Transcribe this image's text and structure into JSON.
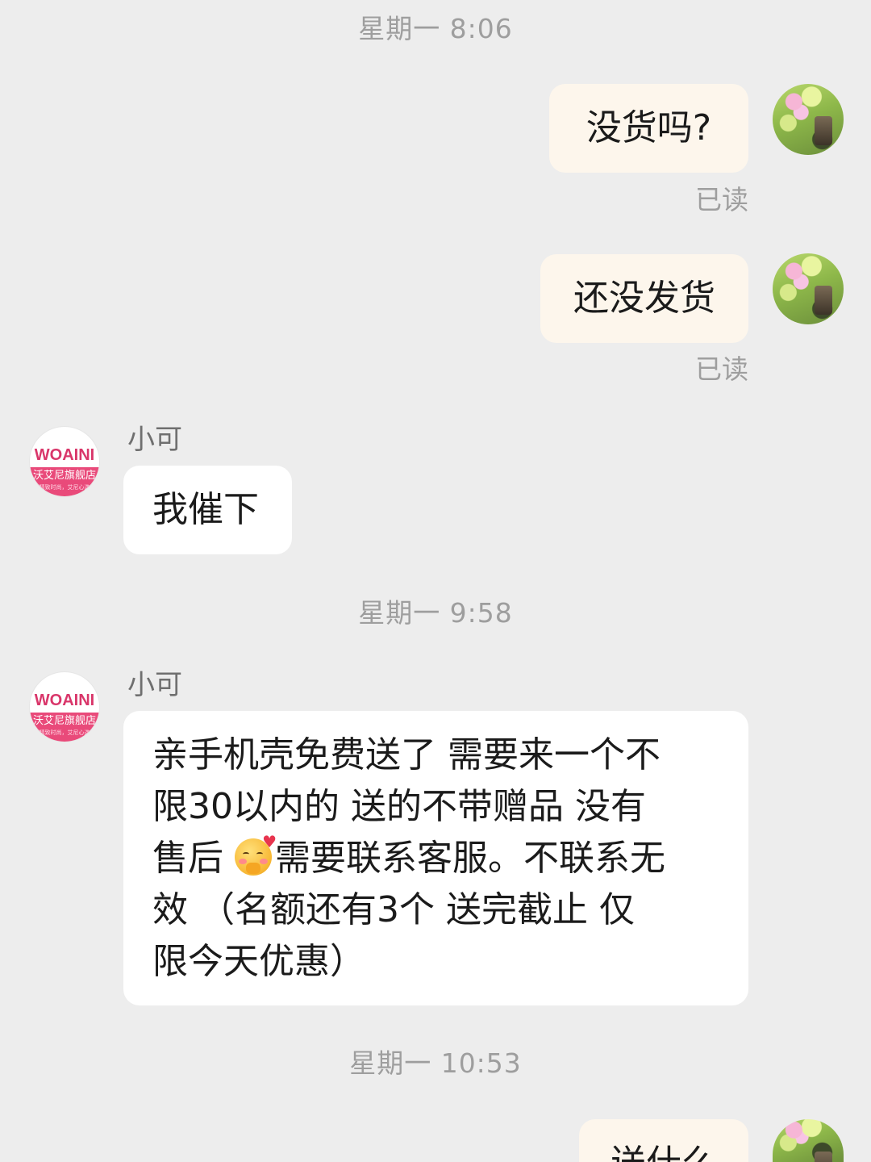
{
  "chat": {
    "timestamps": [
      "星期一 8:06",
      "星期一 9:58",
      "星期一 10:53"
    ],
    "read_label": "已读",
    "sender_name": "小可",
    "shop_avatar": {
      "logo_text": "WOAINI",
      "band_text": "沃艾尼旗舰店",
      "band_subtext": "精致时尚，艾尼心选"
    },
    "messages": [
      {
        "from": "me",
        "text": "没货吗?"
      },
      {
        "from": "me",
        "text": "还没发货"
      },
      {
        "from": "shop",
        "text": "我催下"
      },
      {
        "from": "shop",
        "lines": [
          "亲手机壳免费送了 需要来一个不",
          "限30以内的   送的不带赠品 没有",
          "售后 ",
          "需要联系客服。不联系无",
          "效    （名额还有3个 送完截止 仅",
          "限今天优惠）"
        ],
        "emoji": "face-blowing-kiss-with-heart"
      },
      {
        "from": "me",
        "text": "送什么"
      }
    ]
  },
  "colors": {
    "background": "#ededed",
    "my_bubble": "#fdf6ec",
    "their_bubble": "#ffffff",
    "meta_text": "#9e9e9e"
  }
}
